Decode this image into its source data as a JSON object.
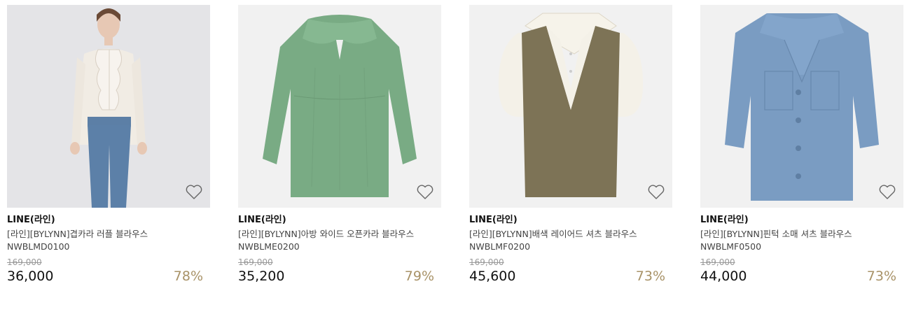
{
  "theme": {
    "discount_color": "#a89267",
    "strike_color": "#999999"
  },
  "products": [
    {
      "brand": "LINE(라인)",
      "name": "[라인][BYLYNN]겹카라 러플 블라우스 NWBLMD0100",
      "original_price": "169,000",
      "price": "36,000",
      "discount": "78%",
      "image": "model-ivory-ruffle-blouse-jeans",
      "wishlist_icon": "heart-outline-icon"
    },
    {
      "brand": "LINE(라인)",
      "name": "[라인][BYLYNN]아방 와이드 오픈카라 블라우스 NWBLME0200",
      "original_price": "169,000",
      "price": "35,200",
      "discount": "79%",
      "image": "green-open-collar-blouse",
      "wishlist_icon": "heart-outline-icon"
    },
    {
      "brand": "LINE(라인)",
      "name": "[라인][BYLYNN]배색 레이어드 셔츠 블라우스 NWBLMF0200",
      "original_price": "169,000",
      "price": "45,600",
      "discount": "73%",
      "image": "khaki-vest-layered-shirt",
      "wishlist_icon": "heart-outline-icon"
    },
    {
      "brand": "LINE(라인)",
      "name": "[라인][BYLYNN]핀턱 소매 셔츠 블라우스 NWBLMF0500",
      "original_price": "169,000",
      "price": "44,000",
      "discount": "73%",
      "image": "blue-pintuck-sleeve-shirt",
      "wishlist_icon": "heart-outline-icon"
    }
  ]
}
